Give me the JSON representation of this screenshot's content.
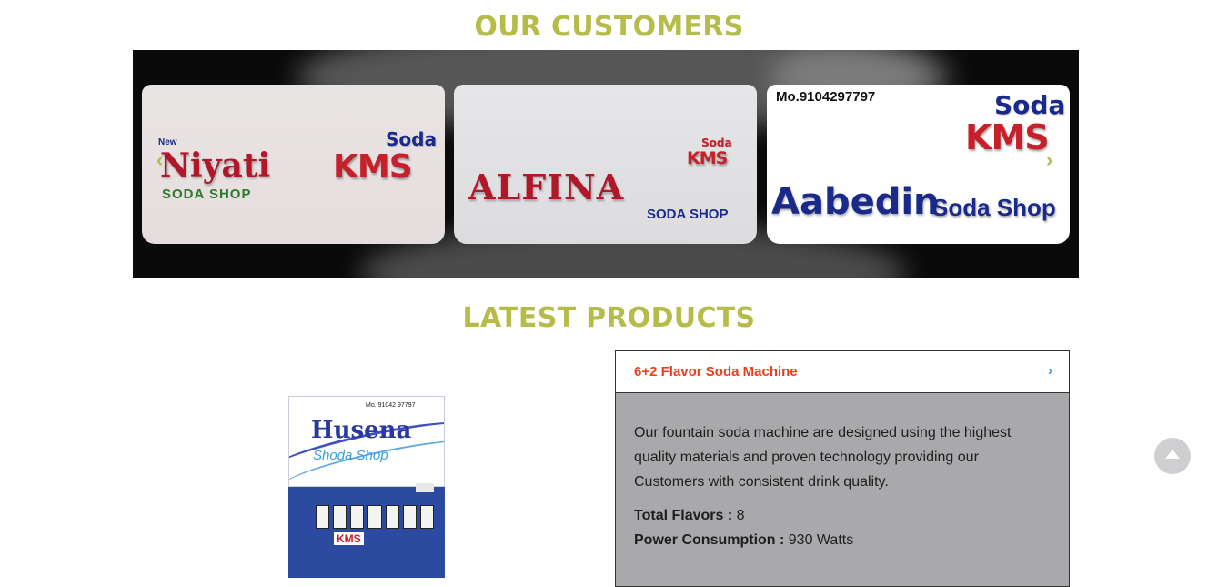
{
  "customers": {
    "title": "OUR CUSTOMERS",
    "slides": [
      {
        "prefix": "New",
        "name": "Niyati",
        "shop": "SODA SHOP",
        "brand_top": "Soda",
        "brand": "KMS"
      },
      {
        "name": "ALFINA",
        "shop": "SODA SHOP",
        "brand_top": "Soda",
        "brand": "KMS"
      },
      {
        "phone": "Mo.9104297797",
        "name": "Aabedin",
        "shop": "Soda Shop",
        "brand_top": "Soda",
        "brand": "KMS"
      }
    ],
    "prev_arrow": "‹",
    "next_arrow": "›"
  },
  "products": {
    "title": "LATEST PRODUCTS",
    "image": {
      "phone": "Mo. 91042 97797",
      "name": "Husena",
      "shop": "Shoda Shop",
      "brand": "KMS"
    },
    "accordion": {
      "title": "6+2 Flavor Soda Machine",
      "chevron": "›",
      "description": "Our fountain soda machine are designed using the highest quality materials and proven technology providing our Customers with consistent drink quality.",
      "specs": [
        {
          "label": "Total Flavors :",
          "value": " 8"
        },
        {
          "label": "Power Consumption :",
          "value": " 930 Watts"
        }
      ]
    }
  },
  "colors": {
    "accent": "#b5bc4a",
    "product_title": "#e8401c",
    "chevron": "#3aa0d8"
  },
  "scroll_top_icon": "chevron-up-icon"
}
